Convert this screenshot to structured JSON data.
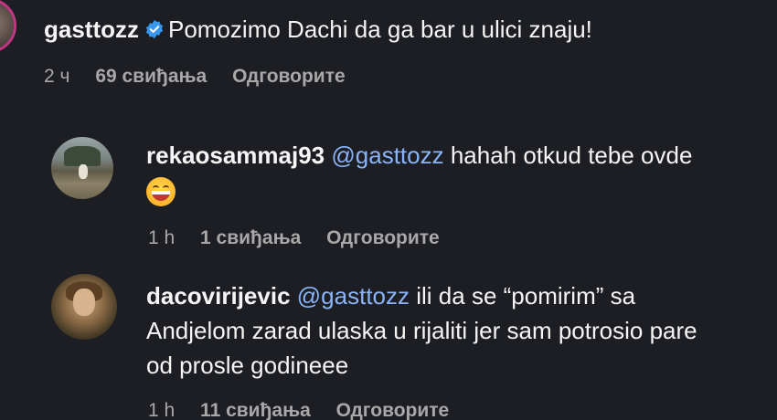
{
  "root_comment": {
    "username": "gasttozz",
    "text": "Pomozimo Dachi da ga bar u ulici znaju!",
    "time": "2 ч",
    "likes": "69 свиђања",
    "reply_label": "Одговорите"
  },
  "replies": [
    {
      "username": "rekaosammaj93",
      "mention": "@gasttozz",
      "text_line1": "hahah otkud tebe ovde",
      "emoji": "grinning-face",
      "time": "1 h",
      "likes": "1 свиђања",
      "reply_label": "Одговорите"
    },
    {
      "username": "dacovirijevic",
      "mention": "@gasttozz",
      "text_line1": "ili da se “pomirim” sa",
      "text_line2": "Andjelom zarad ulaska u rijaliti jer sam potrosio pare",
      "text_line3": "od prosle godineee",
      "time": "1 h",
      "likes": "11 свиђања",
      "reply_label": "Одговорите"
    }
  ],
  "colors": {
    "background": "#1c1e23",
    "mention": "#8ab4f8",
    "meta": "#a8a8a8",
    "verified": "#3897f0",
    "story_ring": "#c13584"
  }
}
